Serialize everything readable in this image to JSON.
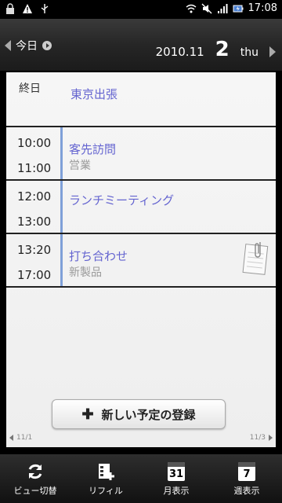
{
  "status_bar": {
    "time": "17:08"
  },
  "header": {
    "today_label": "今日",
    "year_month": "2010.11",
    "day": "2",
    "weekday": "thu"
  },
  "all_day": {
    "label": "終日",
    "title": "東京出張"
  },
  "events": [
    {
      "start": "10:00",
      "end": "11:00",
      "title": "客先訪問",
      "subtitle": "営業",
      "has_memo": false
    },
    {
      "start": "12:00",
      "end": "13:00",
      "title": "ランチミーティング",
      "subtitle": "",
      "has_memo": false
    },
    {
      "start": "13:20",
      "end": "17:00",
      "title": "打ち合わせ",
      "subtitle": "新製品",
      "has_memo": true
    }
  ],
  "new_event_button": {
    "label": "新しい予定の登録"
  },
  "pagination": {
    "prev": "11/1",
    "next": "11/3"
  },
  "toolbar": [
    {
      "label": "ビュー切替",
      "icon": "refresh-icon"
    },
    {
      "label": "リフィル",
      "icon": "refill-icon"
    },
    {
      "label": "月表示",
      "icon": "calendar-31-icon",
      "icon_text": "31"
    },
    {
      "label": "週表示",
      "icon": "calendar-7-icon",
      "icon_text": "7"
    }
  ],
  "colors": {
    "event_title": "#6464d0",
    "event_bar": "#7fa0d8",
    "subtitle": "#9a9a9a"
  }
}
